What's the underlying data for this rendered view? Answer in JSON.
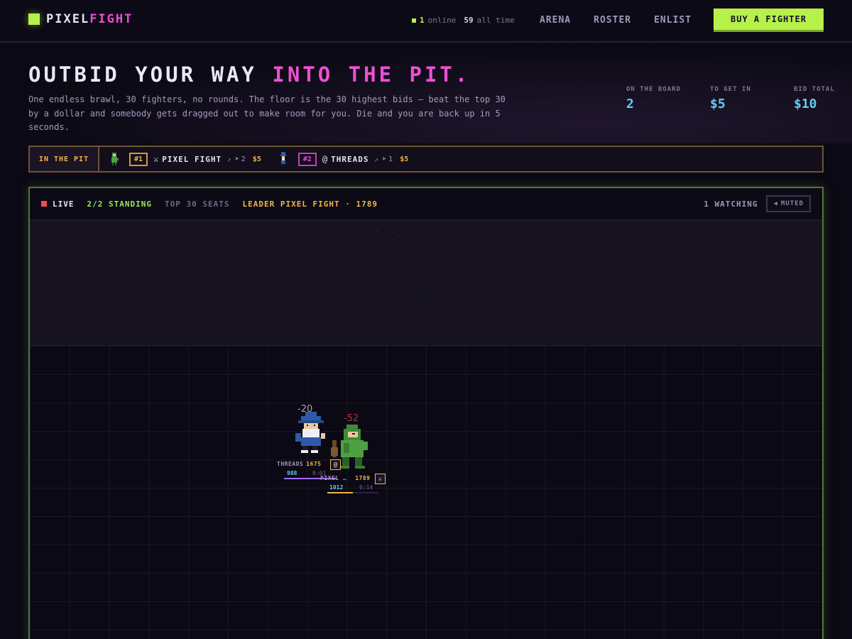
{
  "brand": {
    "part1": "PIXEL",
    "part2": "FIGHT"
  },
  "presence": {
    "online_count": "1",
    "online_label": "online",
    "alltime_count": "59",
    "alltime_label": "all time"
  },
  "nav": {
    "arena": "ARENA",
    "roster": "ROSTER",
    "enlist": "ENLIST",
    "buy": "BUY A FIGHTER"
  },
  "hero": {
    "title_part1": "OUTBID YOUR WAY",
    "title_part2": "INTO THE PIT.",
    "description": "One endless brawl, 30 fighters, no rounds. The floor is the 30 highest bids — beat the top 30 by a dollar and somebody gets dragged out to make room for you. Die and you are back up in 5 seconds.",
    "stats": [
      {
        "label": "ON THE BOARD",
        "value": "2"
      },
      {
        "label": "TO GET IN",
        "value": "$5"
      },
      {
        "label": "BID TOTAL",
        "value": "$10"
      }
    ]
  },
  "pit": {
    "label": "IN THE PIT",
    "entries": [
      {
        "rank": "#1",
        "icon": "⚔",
        "name": "PIXEL FIGHT",
        "count": "2",
        "bid": "$5"
      },
      {
        "rank": "#2",
        "icon": "@",
        "name": "THREADS",
        "count": "1",
        "bid": "$5"
      }
    ]
  },
  "arena": {
    "live": "LIVE",
    "standing": "2/2 STANDING",
    "seats": "TOP 30 SEATS",
    "leader": "LEADER PIXEL FIGHT · 1789",
    "watching": "1 WATCHING",
    "mute": "MUTED"
  },
  "fighters": [
    {
      "name": "THREADS",
      "score": "1675",
      "hp": "988",
      "timer": "0:01",
      "damage": "-20",
      "icon": "@",
      "sprite": "wizard-sprite",
      "hp_fraction": 0.98,
      "color": "#a06cf0"
    },
    {
      "name": "PIXEL …",
      "score": "1789",
      "hp": "1012",
      "timer": "0:14",
      "damage": "-52",
      "icon": "⚔",
      "sprite": "green-knight-sprite",
      "hp_fraction": 0.5,
      "color": "#f1b746"
    }
  ],
  "colors": {
    "accent_green": "#b6f14a",
    "accent_pink": "#ee4fd3",
    "accent_cyan": "#5fcff2",
    "gold": "#f1b746",
    "live_red": "#ef4d4d"
  }
}
